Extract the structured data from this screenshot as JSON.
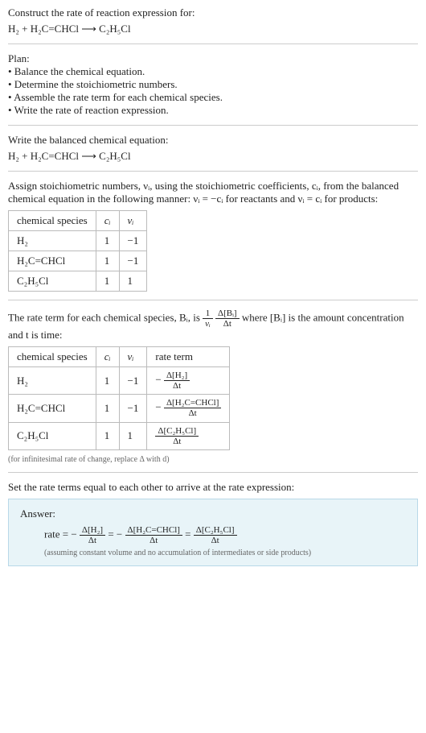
{
  "intro": {
    "title": "Construct the rate of reaction expression for:",
    "equation": "H₂ + H₂C=CHCl  ⟶  C₂H₅Cl"
  },
  "plan": {
    "title": "Plan:",
    "items": [
      "• Balance the chemical equation.",
      "• Determine the stoichiometric numbers.",
      "• Assemble the rate term for each chemical species.",
      "• Write the rate of reaction expression."
    ]
  },
  "balanced": {
    "title": "Write the balanced chemical equation:",
    "equation": "H₂ + H₂C=CHCl  ⟶  C₂H₅Cl"
  },
  "stoich": {
    "text_before": "Assign stoichiometric numbers, νᵢ, using the stoichiometric coefficients, cᵢ, from the balanced chemical equation in the following manner: νᵢ = −cᵢ for reactants and νᵢ = cᵢ for products:",
    "headers": [
      "chemical species",
      "cᵢ",
      "νᵢ"
    ],
    "rows": [
      {
        "species": "H₂",
        "c": "1",
        "v": "−1"
      },
      {
        "species": "H₂C=CHCl",
        "c": "1",
        "v": "−1"
      },
      {
        "species": "C₂H₅Cl",
        "c": "1",
        "v": "1"
      }
    ]
  },
  "rate_terms": {
    "text_before_a": "The rate term for each chemical species, Bᵢ, is ",
    "frac1_num": "1",
    "frac1_den": "νᵢ",
    "frac2_num": "Δ[Bᵢ]",
    "frac2_den": "Δt",
    "text_before_b": " where [Bᵢ] is the amount concentration and t is time:",
    "headers": [
      "chemical species",
      "cᵢ",
      "νᵢ",
      "rate term"
    ],
    "rows": [
      {
        "species": "H₂",
        "c": "1",
        "v": "−1",
        "rt_sign": "−",
        "rt_num": "Δ[H₂]",
        "rt_den": "Δt"
      },
      {
        "species": "H₂C=CHCl",
        "c": "1",
        "v": "−1",
        "rt_sign": "−",
        "rt_num": "Δ[H₂C=CHCl]",
        "rt_den": "Δt"
      },
      {
        "species": "C₂H₅Cl",
        "c": "1",
        "v": "1",
        "rt_sign": "",
        "rt_num": "Δ[C₂H₅Cl]",
        "rt_den": "Δt"
      }
    ],
    "footnote": "(for infinitesimal rate of change, replace Δ with d)"
  },
  "final": {
    "instruction": "Set the rate terms equal to each other to arrive at the rate expression:",
    "answer_label": "Answer:",
    "rate_prefix": "rate = −",
    "t1_num": "Δ[H₂]",
    "t1_den": "Δt",
    "eq1": " = −",
    "t2_num": "Δ[H₂C=CHCl]",
    "t2_den": "Δt",
    "eq2": " = ",
    "t3_num": "Δ[C₂H₅Cl]",
    "t3_den": "Δt",
    "footnote": "(assuming constant volume and no accumulation of intermediates or side products)"
  }
}
